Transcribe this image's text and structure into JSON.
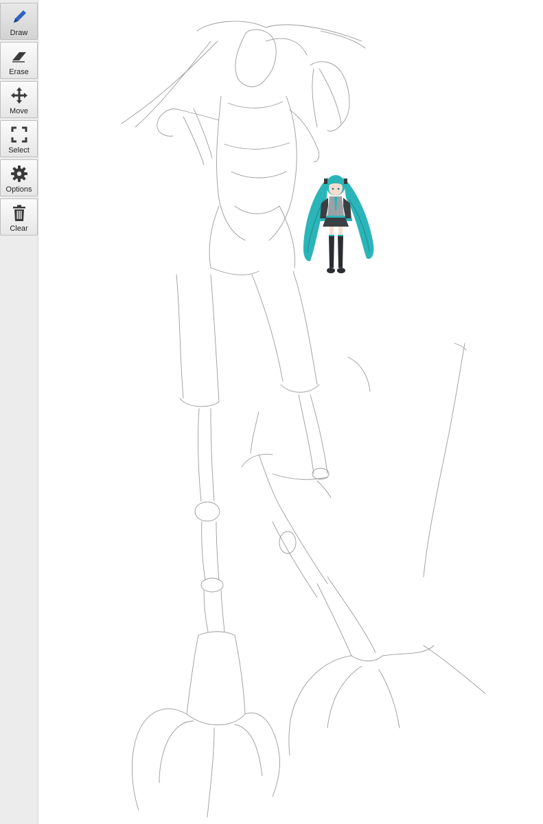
{
  "toolbar": {
    "tools": [
      {
        "label": "Draw",
        "icon": "pencil-icon"
      },
      {
        "label": "Erase",
        "icon": "eraser-icon"
      },
      {
        "label": "Move",
        "icon": "move-arrows-icon"
      },
      {
        "label": "Select",
        "icon": "select-corners-icon"
      },
      {
        "label": "Options",
        "icon": "gear-icon"
      },
      {
        "label": "Clear",
        "icon": "trash-icon"
      }
    ],
    "active_tool": "Draw",
    "accent_color": "#2f63c0",
    "icon_color": "#3a3a3a"
  },
  "canvas": {
    "background": "#ffffff",
    "stroke_color": "#9a9a9a",
    "sticker_hair_color": "#2bb5b8"
  }
}
